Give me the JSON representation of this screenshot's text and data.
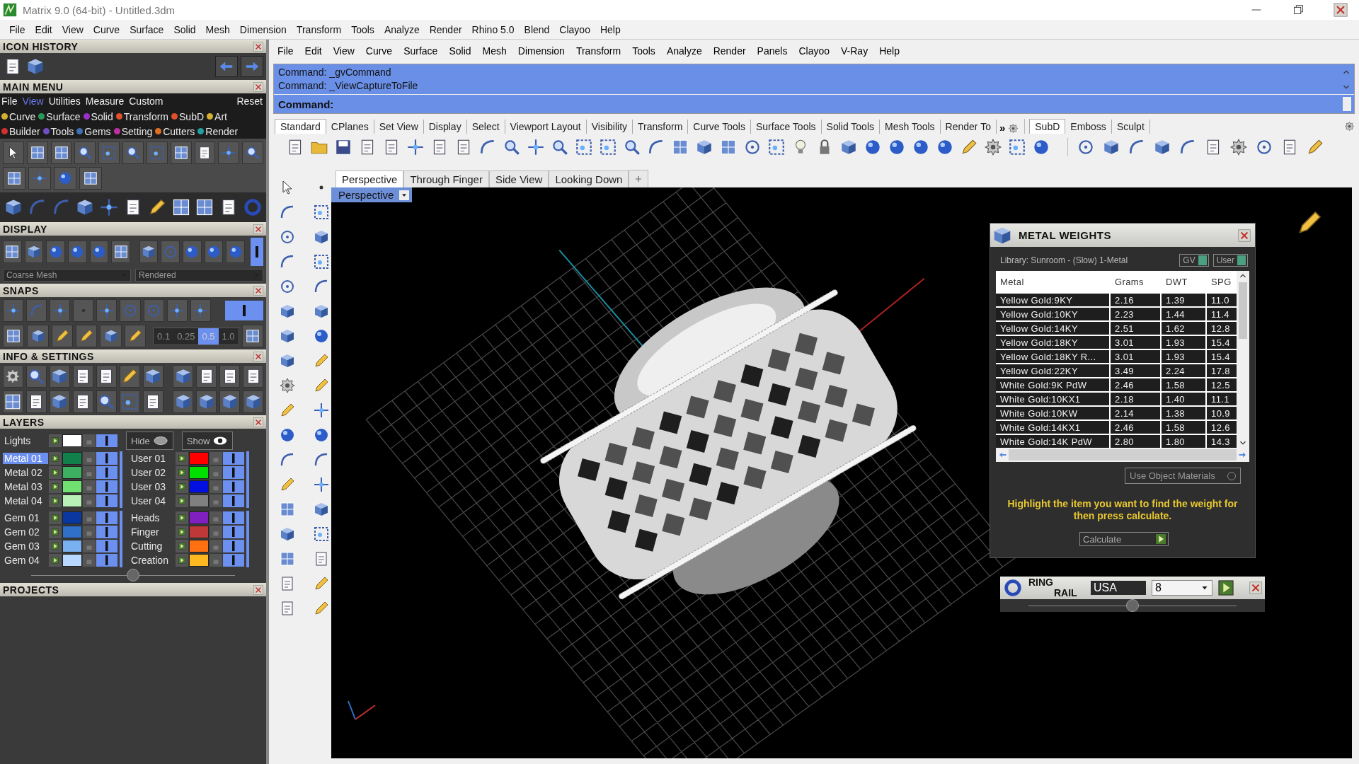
{
  "window": {
    "title": "Matrix 9.0 (64-bit) - Untitled.3dm"
  },
  "menu_bar": [
    "File",
    "Edit",
    "View",
    "Curve",
    "Surface",
    "Solid",
    "Mesh",
    "Dimension",
    "Transform",
    "Tools",
    "Analyze",
    "Render",
    "Rhino 5.0",
    "Blend",
    "Clayoo",
    "Help"
  ],
  "left_panel": {
    "icon_history": {
      "title": "ICON HISTORY"
    },
    "main_menu": {
      "title": "MAIN MENU",
      "tabs": [
        {
          "label": "File",
          "selected": false
        },
        {
          "label": "View",
          "selected": true
        },
        {
          "label": "Utilities",
          "selected": false
        },
        {
          "label": "Measure",
          "selected": false
        },
        {
          "label": "Custom",
          "selected": false
        }
      ],
      "reset": "Reset",
      "categories": [
        [
          {
            "label": "Curve",
            "color": "#d4b030"
          },
          {
            "label": "Surface",
            "color": "#2a9a5a"
          },
          {
            "label": "Solid",
            "color": "#9a30c8"
          },
          {
            "label": "Transform",
            "color": "#e0502a"
          },
          {
            "label": "SubD",
            "color": "#e0502a"
          },
          {
            "label": "Art",
            "color": "#d4b030"
          }
        ],
        [
          {
            "label": "Builder",
            "color": "#d03030"
          },
          {
            "label": "Tools",
            "color": "#7050c0"
          },
          {
            "label": "Gems",
            "color": "#4070b0"
          },
          {
            "label": "Setting",
            "color": "#c030a0"
          },
          {
            "label": "Cutters",
            "color": "#e07020"
          },
          {
            "label": "Render",
            "color": "#20a0a0"
          }
        ]
      ]
    },
    "display": {
      "title": "DISPLAY",
      "mesh_select": "Coarse Mesh",
      "render_select": "Rendered"
    },
    "snaps": {
      "title": "SNAPS",
      "grid_values": [
        {
          "label": "0.1",
          "selected": false
        },
        {
          "label": "0.25",
          "selected": false
        },
        {
          "label": "0.5",
          "selected": true
        },
        {
          "label": "1.0",
          "selected": false
        }
      ]
    },
    "info_settings": {
      "title": "INFO & SETTINGS"
    },
    "layers": {
      "title": "LAYERS",
      "lights": {
        "name": "Lights",
        "color": "#ffffff",
        "visible": true
      },
      "hide": "Hide",
      "show": "Show",
      "columns": [
        [
          [
            {
              "name": "Metal 01",
              "color": "#12804a",
              "selected": true,
              "visible": true
            },
            {
              "name": "Metal 02",
              "color": "#3cb060",
              "selected": false,
              "visible": true
            },
            {
              "name": "Metal 03",
              "color": "#70e070",
              "selected": false,
              "visible": true
            },
            {
              "name": "Metal 04",
              "color": "#b8f0b8",
              "selected": false,
              "visible": true
            }
          ],
          [
            {
              "name": "Gem 01",
              "color": "#0838a0",
              "selected": false,
              "visible": true
            },
            {
              "name": "Gem 02",
              "color": "#3070c8",
              "selected": false,
              "visible": true
            },
            {
              "name": "Gem 03",
              "color": "#78b0f0",
              "selected": false,
              "visible": true
            },
            {
              "name": "Gem 04",
              "color": "#b8d8ff",
              "selected": false,
              "visible": true
            }
          ]
        ],
        [
          [
            {
              "name": "User 01",
              "color": "#ff0000",
              "selected": false,
              "visible": true
            },
            {
              "name": "User 02",
              "color": "#00e000",
              "selected": false,
              "visible": true
            },
            {
              "name": "User 03",
              "color": "#0010e0",
              "selected": false,
              "visible": true
            },
            {
              "name": "User 04",
              "color": "#808080",
              "selected": false,
              "visible": true
            }
          ],
          [
            {
              "name": "Heads",
              "color": "#8020c0",
              "selected": false,
              "visible": true
            },
            {
              "name": "Finger",
              "color": "#c03838",
              "selected": false,
              "visible": true
            },
            {
              "name": "Cutting",
              "color": "#ff7010",
              "selected": false,
              "visible": true
            },
            {
              "name": "Creation",
              "color": "#ffb820",
              "selected": false,
              "visible": true
            }
          ]
        ]
      ]
    },
    "projects": {
      "title": "PROJECTS"
    }
  },
  "rhino": {
    "menu": [
      "File",
      "Edit",
      "View",
      "Curve",
      "Surface",
      "Solid",
      "Mesh",
      "Dimension",
      "Transform",
      "Tools",
      "Analyze",
      "Render",
      "Panels",
      "Clayoo",
      "V-Ray",
      "Help"
    ],
    "command_history": [
      "Command: _gvCommand",
      "Command: _ViewCaptureToFile"
    ],
    "command_prompt": "Command:",
    "toolbar_tabs": [
      {
        "label": "Standard",
        "selected": true
      },
      {
        "label": "CPlanes",
        "selected": false
      },
      {
        "label": "Set View",
        "selected": false
      },
      {
        "label": "Display",
        "selected": false
      },
      {
        "label": "Select",
        "selected": false
      },
      {
        "label": "Viewport Layout",
        "selected": false
      },
      {
        "label": "Visibility",
        "selected": false
      },
      {
        "label": "Transform",
        "selected": false
      },
      {
        "label": "Curve Tools",
        "selected": false
      },
      {
        "label": "Surface Tools",
        "selected": false
      },
      {
        "label": "Solid Tools",
        "selected": false
      },
      {
        "label": "Mesh Tools",
        "selected": false
      },
      {
        "label": "Render To",
        "selected": false
      }
    ],
    "overflow": "»",
    "side_tabs": [
      {
        "label": "SubD",
        "selected": true
      },
      {
        "label": "Emboss",
        "selected": false
      },
      {
        "label": "Sculpt",
        "selected": false
      }
    ],
    "viewport_tabs": [
      {
        "label": "Perspective",
        "selected": true
      },
      {
        "label": "Through Finger",
        "selected": false
      },
      {
        "label": "Side View",
        "selected": false
      },
      {
        "label": "Looking Down",
        "selected": false
      }
    ],
    "viewport_label": "Perspective"
  },
  "metal_weights": {
    "title": "METAL WEIGHTS",
    "library": "Library: Sunroom - (Slow) 1-Metal",
    "toggles": [
      {
        "label": "GV",
        "on": true
      },
      {
        "label": "User",
        "on": true
      }
    ],
    "columns": [
      "Metal",
      "Grams",
      "DWT",
      "SPG"
    ],
    "rows": [
      [
        "Yellow Gold:9KY",
        "2.16",
        "1.39",
        "11.0"
      ],
      [
        "Yellow Gold:10KY",
        "2.23",
        "1.44",
        "11.4"
      ],
      [
        "Yellow Gold:14KY",
        "2.51",
        "1.62",
        "12.8"
      ],
      [
        "Yellow Gold:18KY",
        "3.01",
        "1.93",
        "15.4"
      ],
      [
        "Yellow Gold:18KY R...",
        "3.01",
        "1.93",
        "15.4"
      ],
      [
        "Yellow Gold:22KY",
        "3.49",
        "2.24",
        "17.8"
      ],
      [
        "White Gold:9K PdW",
        "2.46",
        "1.58",
        "12.5"
      ],
      [
        "White Gold:10KX1",
        "2.18",
        "1.40",
        "11.1"
      ],
      [
        "White Gold:10KW",
        "2.14",
        "1.38",
        "10.9"
      ],
      [
        "White Gold:14KX1",
        "2.46",
        "1.58",
        "12.6"
      ],
      [
        "White Gold:14K PdW",
        "2.80",
        "1.80",
        "14.3"
      ]
    ],
    "use_object_materials": "Use Object Materials",
    "hint": "Highlight the item you want to find the weight for then press calculate.",
    "calculate": "Calculate"
  },
  "ring_rail": {
    "title_top": "RING",
    "title_bottom": "RAIL",
    "standard": "USA",
    "size": "8"
  }
}
